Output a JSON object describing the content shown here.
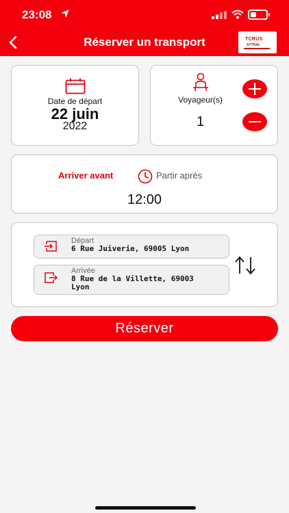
{
  "status_bar": {
    "time": "23:08"
  },
  "header": {
    "title": "Réserver un transport",
    "logo_text_top": "TCRUS",
    "logo_text_bottom": "SYTRAL"
  },
  "date": {
    "label": "Date de départ",
    "day": "22 juin",
    "year": "2022"
  },
  "travelers": {
    "label": "Voyageur(s)",
    "count": "1"
  },
  "time_mode": {
    "arrive_before": "Arriver avant",
    "leave_after": "Partir après",
    "time": "12:00"
  },
  "addresses": {
    "departure_label": "Départ",
    "departure_value": "6 Rue Juiverie, 69005 Lyon",
    "arrival_label": "Arrivée",
    "arrival_value": "8 Rue de la Villette, 69003 Lyon"
  },
  "reserve_button": "Réserver",
  "colors": {
    "brand_red": "#f4000d",
    "accent_red": "#d8000b",
    "card_border": "#c8c8c8"
  },
  "icons": [
    "location-arrow-icon",
    "signal-icon",
    "wifi-icon",
    "battery-icon",
    "back-chevron-icon",
    "calendar-icon",
    "person-seat-icon",
    "plus-icon",
    "minus-icon",
    "clock-icon",
    "enter-icon",
    "exit-icon",
    "swap-arrows-icon"
  ]
}
